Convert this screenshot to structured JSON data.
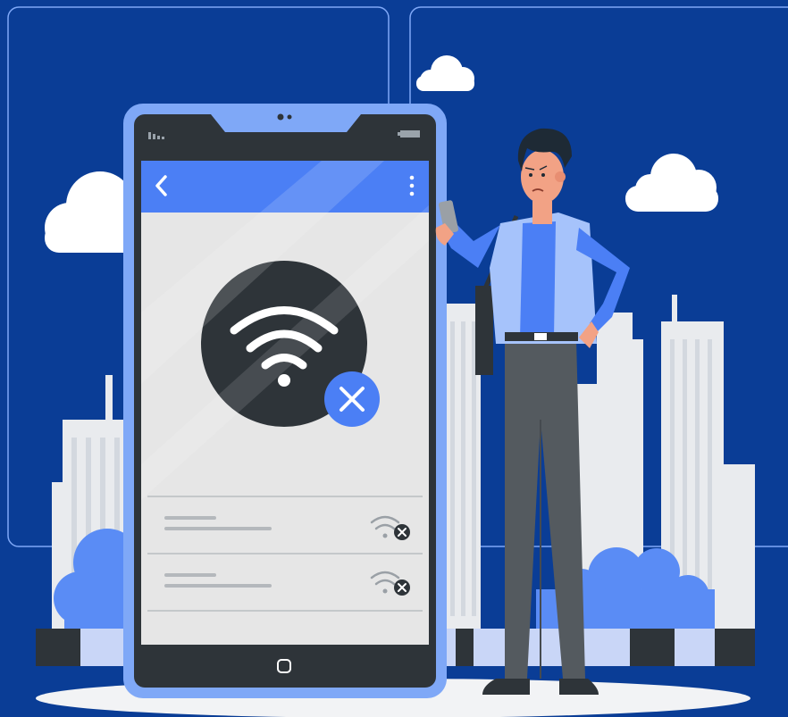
{
  "scene": {
    "subject": "no-wifi-connection-illustration",
    "palette": {
      "background": "#0a3d96",
      "accent": "#4b7ff5",
      "phone_frame": "#7fa8f7",
      "phone_screen": "#e6e6e6",
      "phone_bezel": "#2e3439",
      "buildings": "#e9ebee",
      "clouds": "#ffffff",
      "bushes": "#5a8cf5",
      "trousers": "#545a5f",
      "shirt": "#a6c3fb",
      "tshirt": "#4b7ff5",
      "skin": "#f2a285"
    }
  },
  "phone": {
    "status_bar": {
      "signal_icon": "signal-bars-icon",
      "battery_icon": "battery-icon"
    },
    "app_bar": {
      "back_icon": "chevron-left-icon",
      "menu_icon": "more-vertical-icon"
    },
    "hero": {
      "icon": "wifi-icon",
      "status": "disconnected",
      "badge_icon": "close-icon"
    },
    "networks": [
      {
        "icon": "wifi-off-icon",
        "connected": false
      },
      {
        "icon": "wifi-off-icon",
        "connected": false
      }
    ],
    "home_button_icon": "home-square-icon"
  },
  "person": {
    "expression": "worried",
    "holding": "smartphone"
  }
}
